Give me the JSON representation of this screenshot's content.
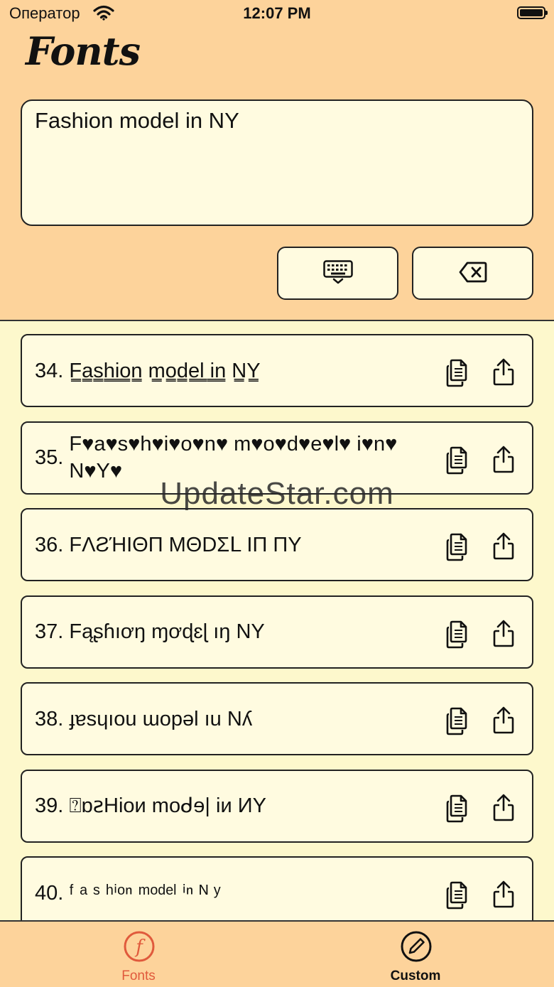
{
  "status_bar": {
    "carrier": "Оператор",
    "time": "12:07 PM"
  },
  "header": {
    "title": "Fonts"
  },
  "input": {
    "value": "Fashion model in NY"
  },
  "buttons": {
    "keyboard_icon": "keyboard-icon",
    "delete_icon": "backspace-icon"
  },
  "results": [
    {
      "index": "34.",
      "text": "F͇a͇s͇h͇i͇o͇n͇ m͇o͇d͇e͇l͇ i͇n͇ N͇Y͇"
    },
    {
      "index": "35.",
      "text": "F♥a♥s♥h♥i♥o♥n♥ m♥o♥d♥e♥l♥ i♥n♥ N♥Y♥"
    },
    {
      "index": "36.",
      "text": "FΛƧΉIΘП MΘDΣᒪ IП ПY"
    },
    {
      "index": "37.",
      "text": "Fąʂɦıơŋ ɱơɖɛɭ ıŋ NY"
    },
    {
      "index": "38.",
      "text": "ɟɐsɥıou ɯopǝl ıu Nʎ"
    },
    {
      "index": "39.",
      "text": "⍰ɒꙅHioᴎ moᑯɘ| iᴎ ИY"
    },
    {
      "index": "40.",
      "text": "ᶠ ᵃ ˢ ʰⁱᵒⁿ ᵐᵒᵈᵉˡ ⁱⁿ ᴺ ʸ"
    }
  ],
  "watermark": "UpdateStar.com",
  "tabs": [
    {
      "label": "Fonts",
      "icon": "font-f-icon",
      "active": true
    },
    {
      "label": "Custom",
      "icon": "pencil-circle-icon",
      "active": false
    }
  ],
  "colors": {
    "header_bg": "#fdd39b",
    "list_bg": "#fdf8cc",
    "card_bg": "#fffbe0",
    "active_tab": "#e05a3c"
  }
}
